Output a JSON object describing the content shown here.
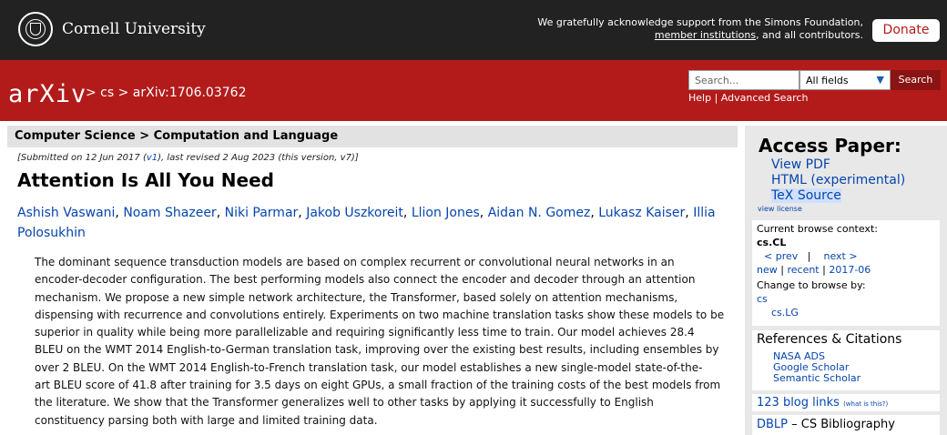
{
  "header": {
    "institution": "Cornell University",
    "ack_line1": "We gratefully acknowledge support from the Simons Foundation,",
    "ack_link": "member institutions",
    "ack_line2_rest": ", and all contributors.",
    "donate": "Donate"
  },
  "arxiv": {
    "logo": "arXiv",
    "breadcrumb": "> cs > arXiv:1706.03762",
    "search_placeholder": "Search...",
    "field_selected": "All fields",
    "search_button": "Search",
    "help": "Help",
    "separator": "|",
    "advanced": "Advanced Search"
  },
  "paper": {
    "subject": "Computer Science > Computation and Language",
    "submitted_pre": "[Submitted on 12 Jun 2017 (",
    "submitted_v1": "v1",
    "submitted_post": "), last revised 2 Aug 2023 (this version, v7)]",
    "title": "Attention Is All You Need",
    "authors": [
      "Ashish Vaswani",
      "Noam Shazeer",
      "Niki Parmar",
      "Jakob Uszkoreit",
      "Llion Jones",
      "Aidan N. Gomez",
      "Lukasz Kaiser",
      "Illia Polosukhin"
    ],
    "abstract": [
      "The dominant sequence transduction models are based on complex recurrent or convolutional neural networks in an",
      "encoder-decoder configuration. The best performing models also connect the encoder and decoder through an attention",
      "mechanism. We propose a new simple network architecture, the Transformer, based solely on attention mechanisms,",
      "dispensing with recurrence and convolutions entirely. Experiments on two machine translation tasks show these models to be",
      "superior in quality while being more parallelizable and requiring significantly less time to train. Our model achieves 28.4",
      "BLEU on the WMT 2014 English-to-German translation task, improving over the existing best results, including ensembles by",
      "over 2 BLEU. On the WMT 2014 English-to-French translation task, our model establishes a new single-model state-of-the-",
      "art BLEU score of 41.8 after training for 3.5 days on eight GPUs, a small fraction of the training costs of the best models from",
      "the literature. We show that the Transformer generalizes well to other tasks by applying it successfully to English",
      "constituency parsing both with large and limited training data."
    ]
  },
  "sidebar": {
    "access_title": "Access Paper:",
    "view_pdf": "View PDF",
    "html": "HTML (experimental)",
    "tex": "TeX Source",
    "license": "view license",
    "context_label": "Current browse context:",
    "context": "cs.CL",
    "prev": "< prev",
    "pipe": "|",
    "next": "next >",
    "new": "new",
    "recent": "recent",
    "month": "2017-06",
    "change_label": "Change to browse by:",
    "cs": "cs",
    "cslg": "cs.LG",
    "refs_title": "References & Citations",
    "nasa": "NASA ADS",
    "google": "Google Scholar",
    "semantic": "Semantic Scholar",
    "blog": "123 blog links",
    "blog_what": "(what is this?)",
    "dblp": "DBLP",
    "dblp_rest": " – CS Bibliography"
  }
}
